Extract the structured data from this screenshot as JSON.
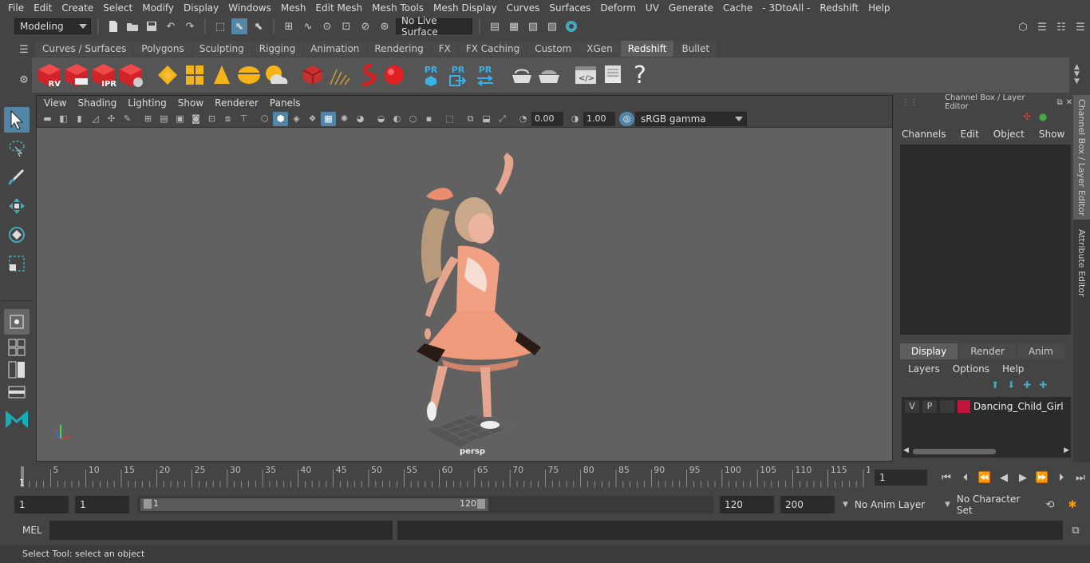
{
  "menu": [
    "File",
    "Edit",
    "Create",
    "Select",
    "Modify",
    "Display",
    "Windows",
    "Mesh",
    "Edit Mesh",
    "Mesh Tools",
    "Mesh Display",
    "Curves",
    "Surfaces",
    "Deform",
    "UV",
    "Generate",
    "Cache",
    "- 3DtoAll -",
    "Redshift",
    "Help"
  ],
  "status": {
    "mode": "Modeling",
    "live_surface": "No Live Surface"
  },
  "shelf_tabs": [
    "Curves / Surfaces",
    "Polygons",
    "Sculpting",
    "Rigging",
    "Animation",
    "Rendering",
    "FX",
    "FX Caching",
    "Custom",
    "XGen",
    "Redshift",
    "Bullet"
  ],
  "active_shelf_tab": "Redshift",
  "shelf": {
    "rv": "RV",
    "ipr": "IPR",
    "pr": "PR",
    "log": ".LOG",
    "help": "?"
  },
  "viewport": {
    "menu": [
      "View",
      "Shading",
      "Lighting",
      "Show",
      "Renderer",
      "Panels"
    ],
    "exposure": "0.00",
    "gamma": "1.00",
    "color_space": "sRGB gamma",
    "camera_label": "persp"
  },
  "channel_box": {
    "title": "Channel Box / Layer Editor",
    "menu": [
      "Channels",
      "Edit",
      "Object",
      "Show"
    ]
  },
  "layer_editor": {
    "tabs": [
      "Display",
      "Render",
      "Anim"
    ],
    "active_tab": "Display",
    "menu": [
      "Layers",
      "Options",
      "Help"
    ],
    "layers": [
      {
        "v": "V",
        "p": "P",
        "name": "Dancing_Child_Girl",
        "color": "#c0143c"
      }
    ]
  },
  "side_tabs": [
    "Channel Box / Layer Editor",
    "Attribute Editor"
  ],
  "timeline": {
    "ticks": [
      "5",
      "10",
      "15",
      "20",
      "25",
      "30",
      "35",
      "40",
      "45",
      "50",
      "55",
      "60",
      "65",
      "70",
      "75",
      "80",
      "85",
      "90",
      "95",
      "100",
      "105",
      "110",
      "115",
      "12"
    ],
    "start_marker": "1",
    "current_frame": "1"
  },
  "range": {
    "start": "1",
    "current": "1",
    "slider_start": "1",
    "slider_end": "120",
    "end": "120",
    "max": "200",
    "anim_layer": "No Anim Layer",
    "char_set": "No Character Set"
  },
  "cmd": {
    "label": "MEL"
  },
  "help_line": "Select Tool: select an object"
}
